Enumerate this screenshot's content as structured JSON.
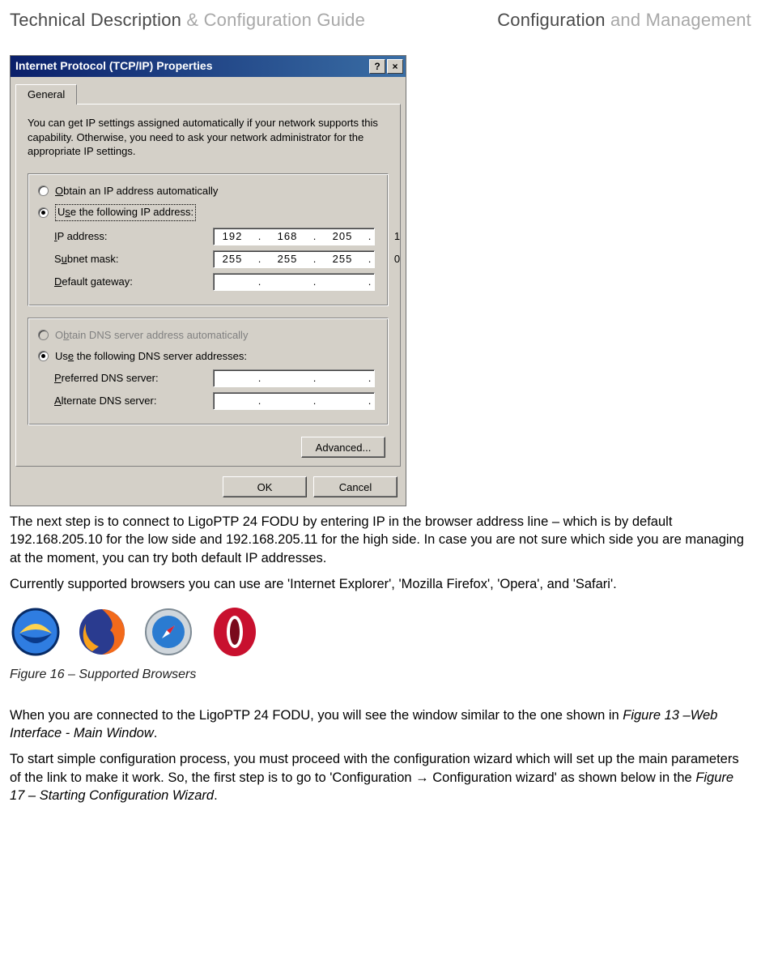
{
  "header": {
    "left_dark": "Technical Description",
    "left_light": " & Configuration Guide",
    "right_dark": "Configuration",
    "right_light": " and Management"
  },
  "dialog": {
    "title": "Internet Protocol (TCP/IP) Properties",
    "help_btn": "?",
    "close_btn": "×",
    "tab": "General",
    "description": "You can get IP settings assigned automatically if your network supports this capability. Otherwise, you need to ask your network administrator for the appropriate IP settings.",
    "ip_group": {
      "auto_label": "Obtain an IP address automatically",
      "manual_label": "Use the following IP address:",
      "ip_label": "IP address:",
      "ip_value": [
        "192",
        "168",
        "205",
        "1"
      ],
      "subnet_label": "Subnet mask:",
      "subnet_value": [
        "255",
        "255",
        "255",
        "0"
      ],
      "gateway_label": "Default gateway:",
      "gateway_value": [
        "",
        "",
        "",
        ""
      ]
    },
    "dns_group": {
      "auto_label": "Obtain DNS server address automatically",
      "manual_label": "Use the following DNS server addresses:",
      "pref_label": "Preferred DNS server:",
      "pref_value": [
        "",
        "",
        "",
        ""
      ],
      "alt_label": "Alternate DNS server:",
      "alt_value": [
        "",
        "",
        "",
        ""
      ]
    },
    "advanced_btn": "Advanced...",
    "ok_btn": "OK",
    "cancel_btn": "Cancel"
  },
  "body": {
    "p1": "The next step is to connect to LigoPTP 24 FODU by entering IP in the browser address line – which is by default 192.168.205.10 for the low side and 192.168.205.11 for the high side. In case you are not sure which side you are managing at the moment, you can try both default IP addresses.",
    "p2": "Currently supported browsers you can use are 'Internet Explorer', 'Mozilla Firefox', 'Opera', and 'Safari'.",
    "fig16": "Figure 16 – Supported Browsers",
    "p3a": "When you are connected to the LigoPTP 24 FODU, you will see the window similar to the one shown in ",
    "p3b": "Figure 13 –Web Interface - Main Window",
    "p3c": ".",
    "p4a": "To start simple configuration process, you must proceed with the configuration wizard which will set up the main parameters of the link to make it work. So, the first step is to go to 'Configuration → Configuration wizard' as shown below in the ",
    "p4b": "Figure 17 – Starting Configuration Wizard",
    "p4c": "."
  },
  "icons": {
    "ie": "internet-explorer-icon",
    "ff": "firefox-icon",
    "sf": "safari-icon",
    "op": "opera-icon"
  }
}
